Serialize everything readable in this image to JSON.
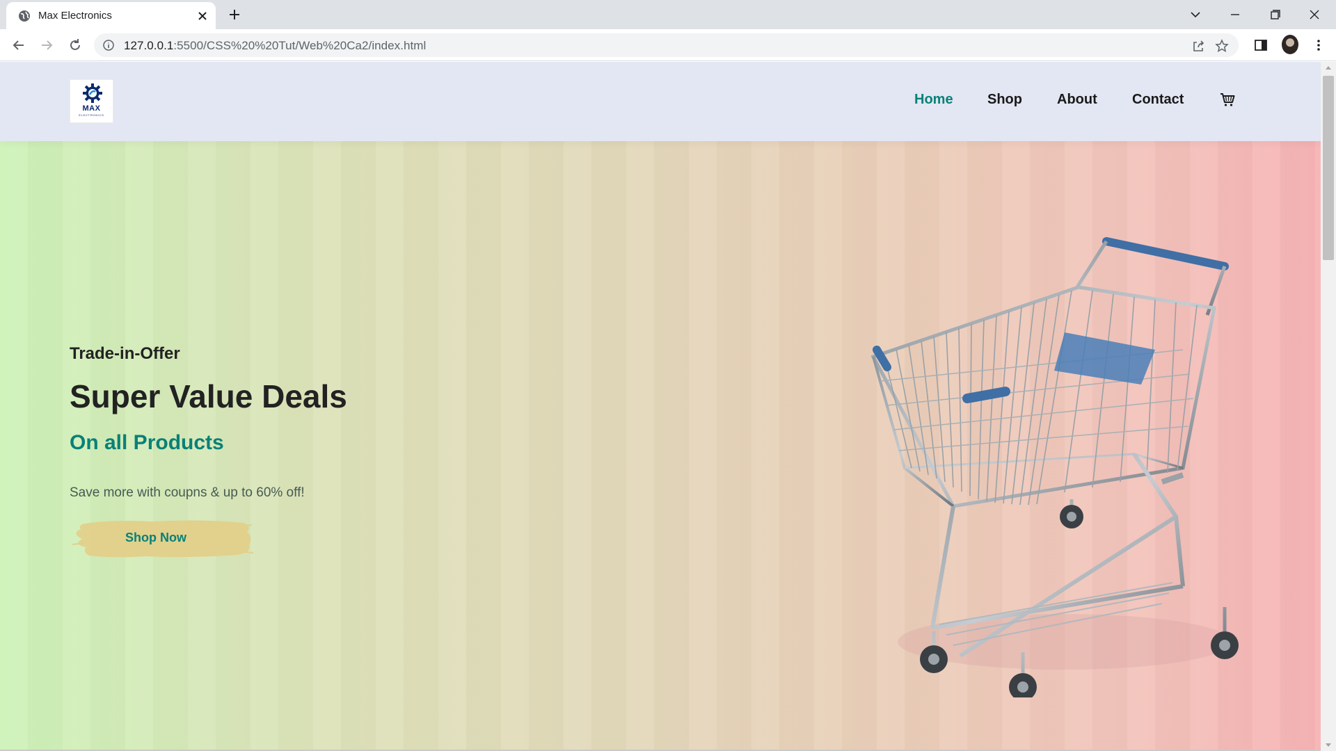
{
  "browser": {
    "tab": {
      "title": "Max Electronics"
    },
    "address_bar": {
      "host": "127.0.0.1",
      "path": ":5500/CSS%20%20Tut/Web%20Ca2/index.html"
    }
  },
  "site": {
    "logo": {
      "name": "MAX",
      "tagline": "ELECTRONICS"
    },
    "nav": {
      "items": [
        {
          "label": "Home",
          "active": true
        },
        {
          "label": "Shop",
          "active": false
        },
        {
          "label": "About",
          "active": false
        },
        {
          "label": "Contact",
          "active": false
        }
      ],
      "cart_icon": "shopping-cart-icon"
    },
    "hero": {
      "kicker": "Trade-in-Offer",
      "title": "Super Value Deals",
      "subtitle": "On all Products",
      "text": "Save more with coupns & up to 60% off!",
      "button_label": "Shop Now",
      "image": "shopping-cart-illustration"
    }
  },
  "colors": {
    "accent": "#088178",
    "header_bg": "#e3e6f3",
    "hero_gradient_start": "#cdf2b8",
    "hero_gradient_end": "#f7b3b5",
    "button_brush": "#e2d08a"
  }
}
